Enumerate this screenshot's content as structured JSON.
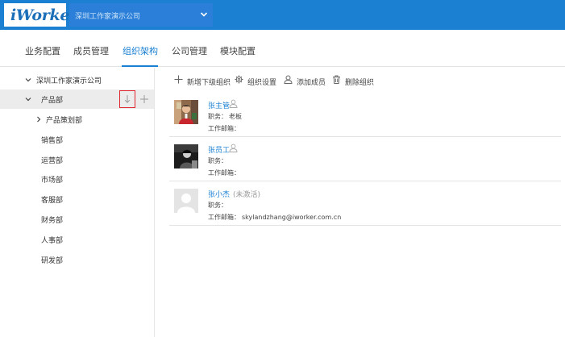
{
  "header": {
    "logo_text": "iWorker",
    "company_name": "深圳工作家演示公司"
  },
  "nav": {
    "tabs": [
      {
        "label": "业务配置"
      },
      {
        "label": "成员管理"
      },
      {
        "label": "组织架构"
      },
      {
        "label": "公司管理"
      },
      {
        "label": "模块配置"
      }
    ],
    "active_tab": "组织架构"
  },
  "tree": {
    "root": "深圳工作家演示公司",
    "selected": "产品部",
    "selected_children": [
      "产品策划部"
    ],
    "departments": [
      "销售部",
      "运营部",
      "市场部",
      "客服部",
      "财务部",
      "人事部",
      "研发部"
    ]
  },
  "toolbar": {
    "add_sub_org": "新增下级组织",
    "org_settings": "组织设置",
    "add_member": "添加成员",
    "delete_org": "删除组织"
  },
  "members": [
    {
      "name": "张主管",
      "status": "",
      "position_label": "职务：",
      "position": "老板",
      "email_label": "工作邮箱：",
      "email": ""
    },
    {
      "name": "张员工",
      "status": "",
      "position_label": "职务：",
      "position": "",
      "email_label": "工作邮箱：",
      "email": ""
    },
    {
      "name": "张小杰",
      "status": "(未激活)",
      "position_label": "职务：",
      "position": "",
      "email_label": "工作邮箱：",
      "email": "skylandzhang@iworker.com.cn"
    }
  ],
  "colors": {
    "brand_blue": "#1b80d2",
    "highlight_red": "#e0262e",
    "selected_bg": "#ececec"
  }
}
